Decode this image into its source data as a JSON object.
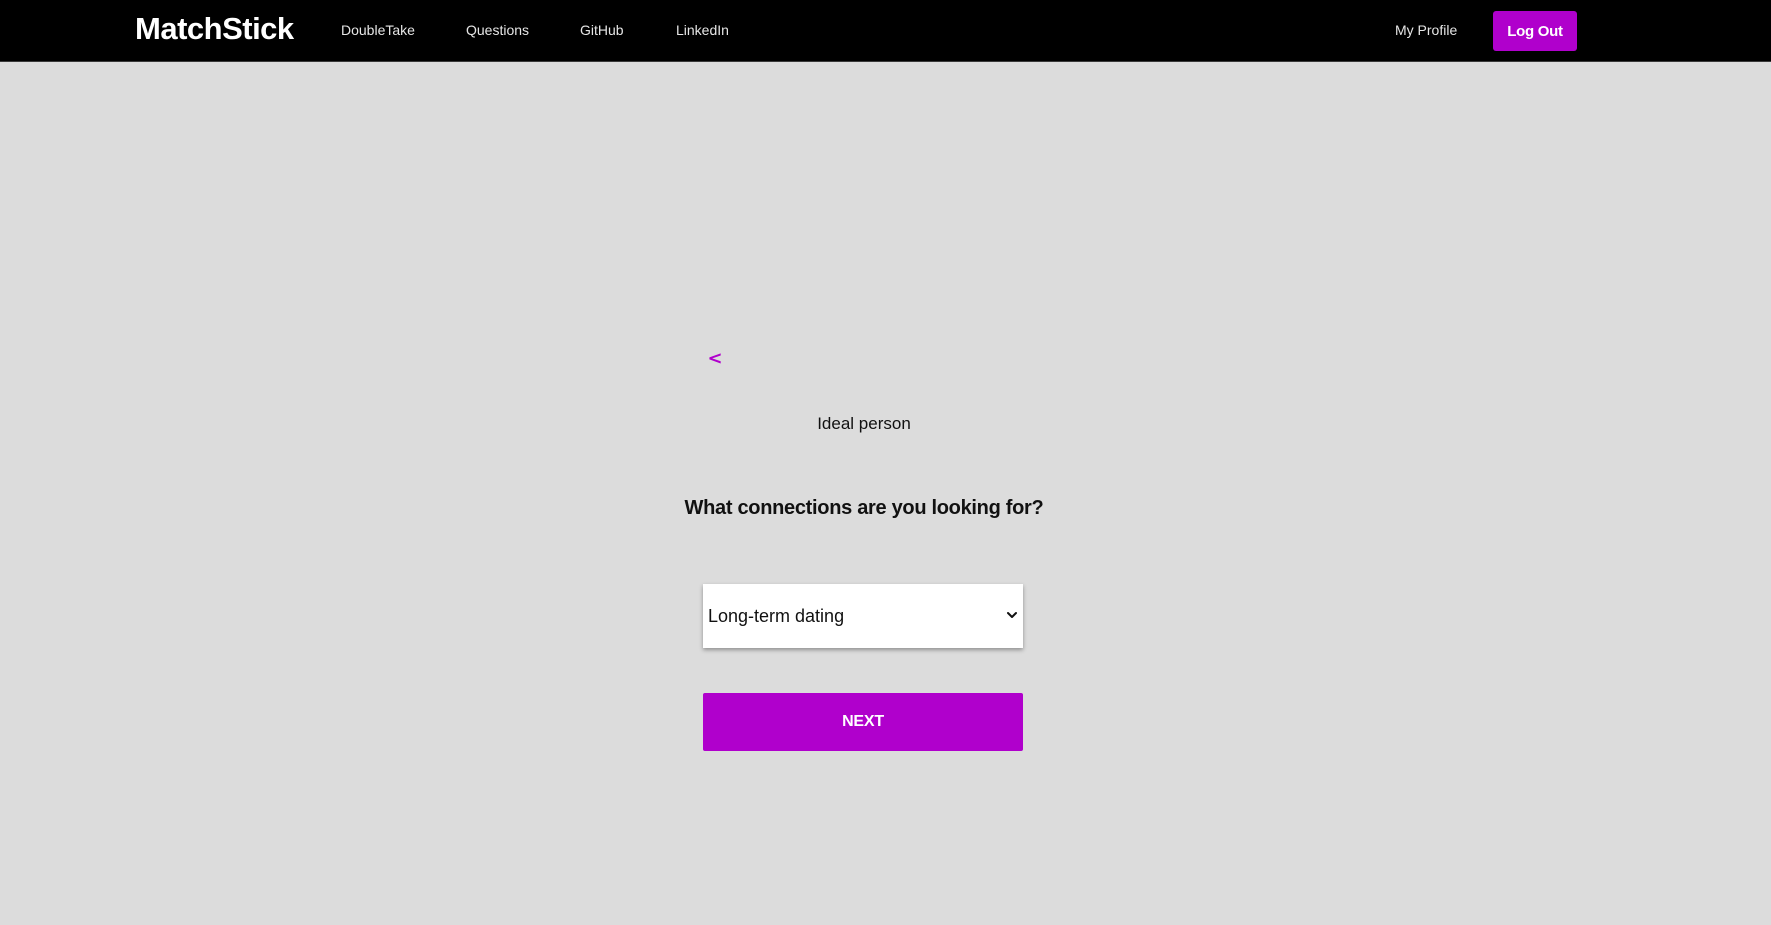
{
  "navbar": {
    "brand": "MatchStick",
    "links": [
      {
        "label": "DoubleTake"
      },
      {
        "label": "Questions"
      },
      {
        "label": "GitHub"
      },
      {
        "label": "LinkedIn"
      }
    ],
    "profile_label": "My Profile",
    "logout_label": "Log Out"
  },
  "form": {
    "back_label": "<",
    "step_label": "Ideal person",
    "question": "What connections are you looking for?",
    "select": {
      "selected": "Long-term dating",
      "icon": "chevron-down-icon"
    },
    "next_label": "NEXT"
  },
  "colors": {
    "accent": "#b000cc",
    "navbar_bg": "#000000",
    "page_bg": "#dcdcdc"
  }
}
